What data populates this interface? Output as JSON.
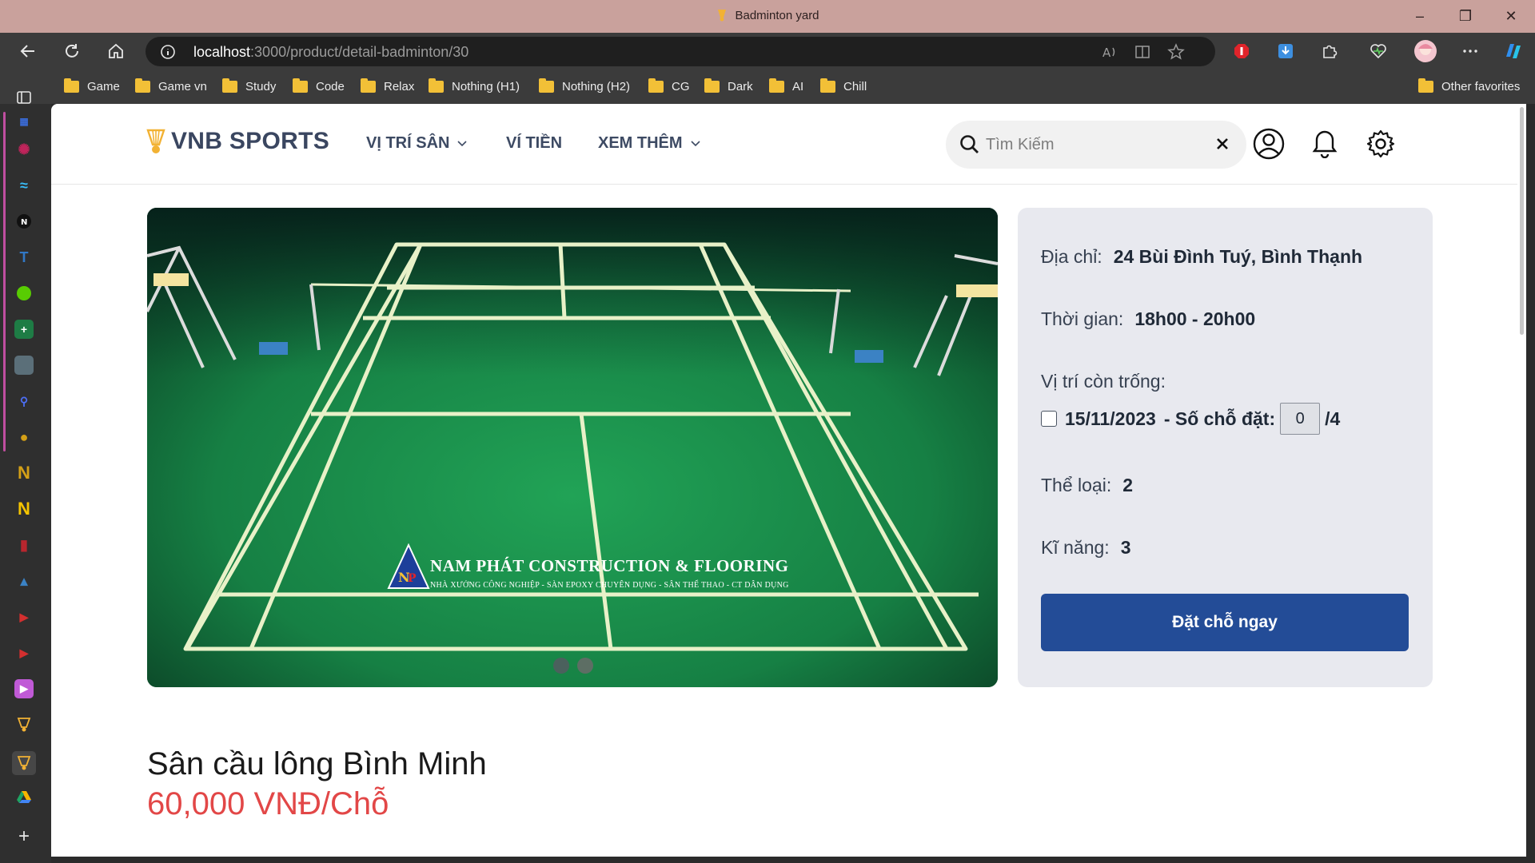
{
  "window": {
    "title": "Badminton yard"
  },
  "browser": {
    "url_host": "localhost",
    "url_path": ":3000/product/detail-badminton/30"
  },
  "bookmarks": [
    "Game",
    "Game vn",
    "Study",
    "Code",
    "Relax",
    "Nothing (H1)",
    "Nothing (H2)",
    "CG",
    "Dark",
    "AI",
    "Chill"
  ],
  "other_favorites": "Other favorites",
  "site": {
    "brand": "VNB SPORTS",
    "nav": {
      "positions": "VỊ TRÍ SÂN",
      "wallet": "VÍ TIỀN",
      "more": "XEM THÊM"
    },
    "search_placeholder": "Tìm Kiếm"
  },
  "carousel": {
    "watermark_title": "NAM PHÁT CONSTRUCTION & FLOORING",
    "watermark_subtitle": "NHÀ XƯỞNG CÔNG NGHIỆP - SÀN EPOXY CHUYÊN DỤNG - SÂN THỂ THAO - CT DÂN DỤNG",
    "slide_count": 2,
    "active_slide": 1
  },
  "booking": {
    "address_label": "Địa chỉ:",
    "address_value": "24 Bùi Đình Tuý, Bình Thạnh",
    "time_label": "Thời gian:",
    "time_value": "18h00 - 20h00",
    "slots_label": "Vị trí còn trống:",
    "slot_date": "15/11/2023",
    "slot_count_label": "- Số chỗ đặt:",
    "slot_count_value": "0",
    "slot_total": "/4",
    "category_label": "Thể loại:",
    "category_value": "2",
    "skill_label": "Kĩ năng:",
    "skill_value": "3",
    "book_button": "Đặt chỗ ngay"
  },
  "product": {
    "name": "Sân cầu lông Bình Minh",
    "price": "60,000 VNĐ/Chỗ"
  },
  "colors": {
    "primary_button": "#234c97",
    "price": "#e24747",
    "title_bar": "#c9a19c",
    "court_green": "#1f8a4a"
  }
}
